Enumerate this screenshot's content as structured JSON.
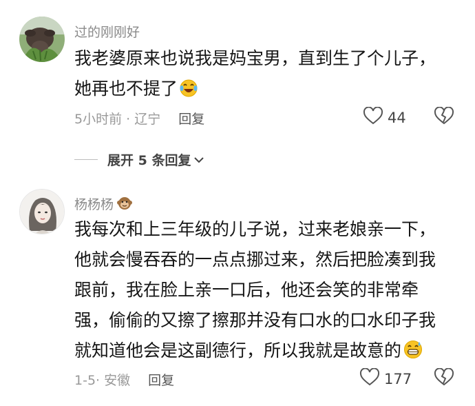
{
  "comments": [
    {
      "username": "过的刚刚好",
      "lines": [
        "我老婆原来也说我是妈宝男，直到生了个儿子，",
        "她再也不提了"
      ],
      "time": "5小时前",
      "location": "辽宁",
      "reply_label": "回复",
      "likes": "44",
      "emoji": "laughing-tears-emoji"
    },
    {
      "username": "杨杨杨",
      "lines": [
        "我每次和上三年级的儿子说，过来老娘亲一下，",
        "他就会慢吞吞的一点点挪过来，然后把脸凑到我",
        "跟前，我在脸上亲一口后，他还会笑的非常牵",
        "强，偷偷的又擦了擦那并没有口水的口水印子我",
        "就知道他会是这副德行，所以我就是故意的"
      ],
      "time": "1-5",
      "location": "安徽",
      "reply_label": "回复",
      "likes": "177",
      "emoji": "grin-sweat-emoji",
      "badge": "monkey-emoji"
    }
  ],
  "expand_replies_label": "展开 5 条回复",
  "colors": {
    "muted": "#999999",
    "text": "#161616",
    "emoji_yellow": "#f7c325"
  }
}
